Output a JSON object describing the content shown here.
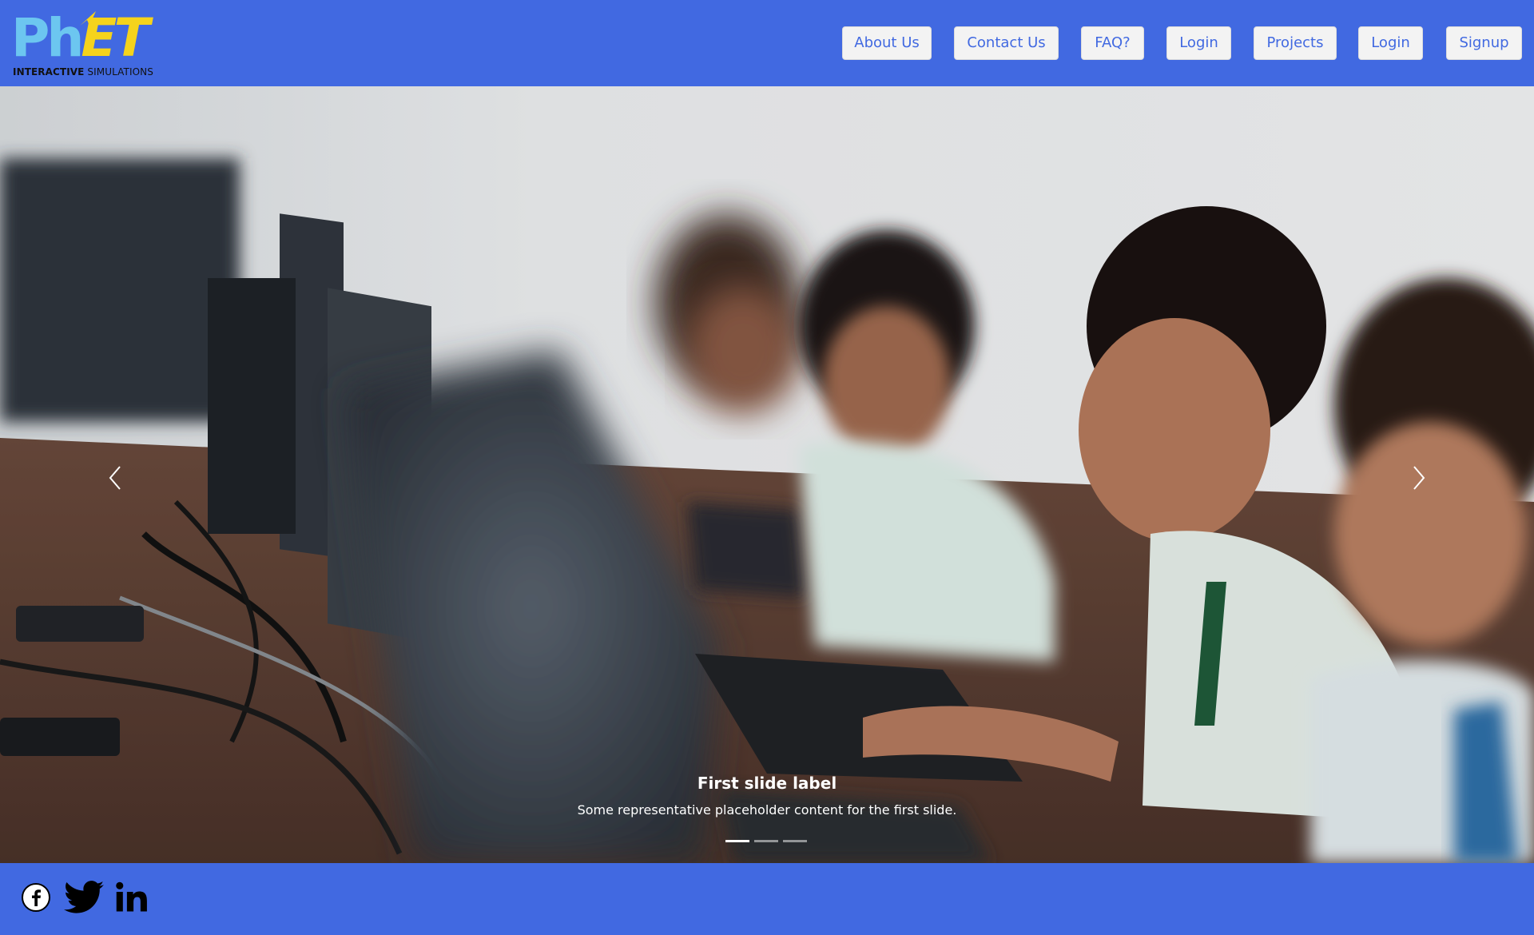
{
  "header": {
    "logo": {
      "main": "PhET",
      "sub_bold": "INTERACTIVE",
      "sub_rest": " SIMULATIONS"
    },
    "nav": [
      {
        "label": "About Us"
      },
      {
        "label": "Contact Us"
      },
      {
        "label": "FAQ?"
      },
      {
        "label": "Login"
      },
      {
        "label": "Projects"
      },
      {
        "label": "Login"
      },
      {
        "label": "Signup"
      }
    ]
  },
  "carousel": {
    "caption_title": "First slide label",
    "caption_text": "Some representative placeholder content for the first slide.",
    "indicator_count": 3,
    "active_index": 0,
    "prev_icon": "chevron-left-icon",
    "next_icon": "chevron-right-icon"
  },
  "footer": {
    "social": [
      {
        "name": "facebook-icon"
      },
      {
        "name": "twitter-icon"
      },
      {
        "name": "linkedin-icon"
      }
    ]
  },
  "colors": {
    "brand_blue": "#4169e1",
    "logo_blue": "#6cc6f0",
    "logo_yellow": "#f5d31c",
    "button_bg": "#f3f3f3"
  }
}
